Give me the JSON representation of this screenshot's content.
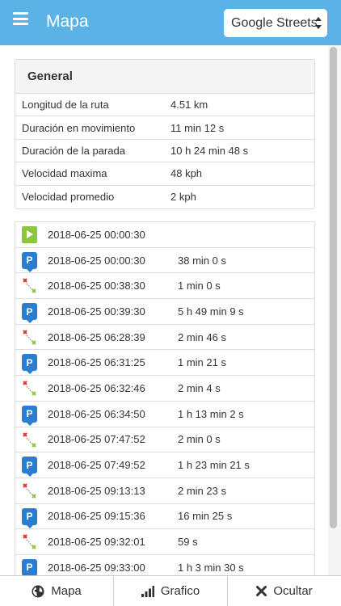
{
  "header": {
    "title": "Mapa",
    "map_select": {
      "value": "Google Streets"
    },
    "accent_color": "#5bb2e6"
  },
  "general": {
    "title": "General",
    "rows": [
      {
        "label": "Longitud de la ruta",
        "value": "4.51 km"
      },
      {
        "label": "Duración en movimiento",
        "value": "11 min 12 s"
      },
      {
        "label": "Duración de la parada",
        "value": "10 h 24 min 48 s"
      },
      {
        "label": "Velocidad maxima",
        "value": "48 kph"
      },
      {
        "label": "Velocidad promedio",
        "value": "2 kph"
      }
    ]
  },
  "events": [
    {
      "icon": "route-start-icon",
      "datetime": "2018-06-25 00:00:30",
      "duration": ""
    },
    {
      "icon": "parking-icon",
      "datetime": "2018-06-25 00:00:30",
      "duration": "38 min 0 s"
    },
    {
      "icon": "route-segment-icon",
      "datetime": "2018-06-25 00:38:30",
      "duration": "1 min 0 s"
    },
    {
      "icon": "parking-icon",
      "datetime": "2018-06-25 00:39:30",
      "duration": "5 h 49 min 9 s"
    },
    {
      "icon": "route-segment-icon",
      "datetime": "2018-06-25 06:28:39",
      "duration": "2 min 46 s"
    },
    {
      "icon": "parking-icon",
      "datetime": "2018-06-25 06:31:25",
      "duration": "1 min 21 s"
    },
    {
      "icon": "route-segment-icon",
      "datetime": "2018-06-25 06:32:46",
      "duration": "2 min 4 s"
    },
    {
      "icon": "parking-icon",
      "datetime": "2018-06-25 06:34:50",
      "duration": "1 h 13 min 2 s"
    },
    {
      "icon": "route-segment-icon",
      "datetime": "2018-06-25 07:47:52",
      "duration": "2 min 0 s"
    },
    {
      "icon": "parking-icon",
      "datetime": "2018-06-25 07:49:52",
      "duration": "1 h 23 min 21 s"
    },
    {
      "icon": "route-segment-icon",
      "datetime": "2018-06-25 09:13:13",
      "duration": "2 min 23 s"
    },
    {
      "icon": "parking-icon",
      "datetime": "2018-06-25 09:15:36",
      "duration": "16 min 25 s"
    },
    {
      "icon": "route-segment-icon",
      "datetime": "2018-06-25 09:32:01",
      "duration": "59 s"
    },
    {
      "icon": "parking-icon",
      "datetime": "2018-06-25 09:33:00",
      "duration": "1 h 3 min 30 s"
    }
  ],
  "parking_letter": "P",
  "footer": {
    "map_label": "Mapa",
    "chart_label": "Grafico",
    "hide_label": "Ocultar"
  }
}
